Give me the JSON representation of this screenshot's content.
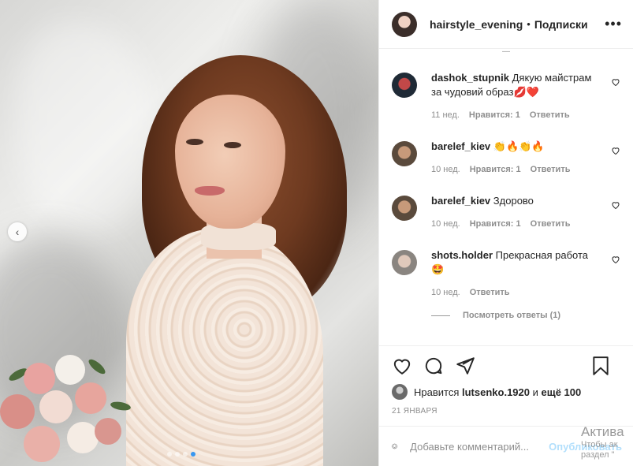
{
  "post": {
    "author": "hairstyle_evening",
    "separator": "•",
    "follow_label": "Подписки",
    "more_label": "•••",
    "carousel": {
      "dots_total": 4,
      "active_index": 3,
      "prev_arrow": "‹"
    }
  },
  "comments_hint": "—",
  "comments": [
    {
      "user": "dashok_stupnik",
      "text": "Дякую майстрам за чудовий образ💋❤️",
      "time": "11 нед.",
      "likes": "Нравится: 1",
      "reply": "Ответить"
    },
    {
      "user": "barelef_kiev",
      "text": "👏🔥👏🔥",
      "time": "10 нед.",
      "likes": "Нравится: 1",
      "reply": "Ответить"
    },
    {
      "user": "barelef_kiev",
      "text": "Здорово",
      "time": "10 нед.",
      "likes": "Нравится: 1",
      "reply": "Ответить"
    },
    {
      "user": "shots.holder",
      "text": "Прекрасная работа 🤩",
      "time": "10 нед.",
      "likes": "",
      "reply": "Ответить"
    }
  ],
  "view_replies": "Посмотреть ответы (1)",
  "likes_line": {
    "prefix": "Нравится",
    "user": "lutsenko.1920",
    "middle": "и",
    "others": "ещё 100"
  },
  "date": "21 ЯНВАРЯ",
  "add_comment": {
    "placeholder": "Добавьте комментарий...",
    "post_label": "Опубликовать"
  },
  "overlay": {
    "line1": "Актива",
    "line2": "Чтобы ак",
    "line3": "раздел \""
  },
  "icons": [
    "heart-icon",
    "comment-icon",
    "share-icon",
    "bookmark-icon",
    "emoji-icon",
    "chevron-left-icon",
    "more-icon"
  ],
  "colors": {
    "link_blue": "#3897f0",
    "muted": "#8e8e8e",
    "heart_red": "#ed4956"
  }
}
